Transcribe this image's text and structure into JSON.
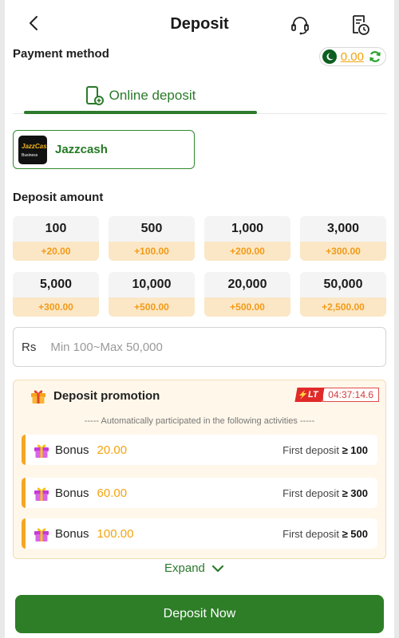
{
  "header": {
    "title": "Deposit"
  },
  "payment": {
    "label": "Payment method",
    "balance": "0.00"
  },
  "tabs": [
    {
      "label": "Online deposit"
    }
  ],
  "method": {
    "name": "Jazzcash",
    "logo_line1": "JazzCash",
    "logo_line2": "Business"
  },
  "deposit_amount": {
    "label": "Deposit amount",
    "options": [
      {
        "value": "100",
        "bonus": "+20.00"
      },
      {
        "value": "500",
        "bonus": "+100.00"
      },
      {
        "value": "1,000",
        "bonus": "+200.00"
      },
      {
        "value": "3,000",
        "bonus": "+300.00"
      },
      {
        "value": "5,000",
        "bonus": "+300.00"
      },
      {
        "value": "10,000",
        "bonus": "+500.00"
      },
      {
        "value": "20,000",
        "bonus": "+500.00"
      },
      {
        "value": "50,000",
        "bonus": "+2,500.00"
      }
    ]
  },
  "amount_input": {
    "currency": "Rs",
    "placeholder": "Min 100~Max 50,000",
    "value": ""
  },
  "promotion": {
    "title": "Deposit promotion",
    "badge": "LT",
    "timer": "04:37:14.6",
    "subtitle": "----- Automatically participated in the following activities -----",
    "bonuses": [
      {
        "label": "Bonus",
        "amount": "20.00",
        "requirement": "First deposit",
        "threshold": "≥ 100"
      },
      {
        "label": "Bonus",
        "amount": "60.00",
        "requirement": "First deposit",
        "threshold": "≥ 300"
      },
      {
        "label": "Bonus",
        "amount": "100.00",
        "requirement": "First deposit",
        "threshold": "≥ 500"
      }
    ]
  },
  "expand_label": "Expand",
  "deposit_button": "Deposit Now",
  "colors": {
    "primary_green": "#2d7e27",
    "accent_orange": "#f3a40e",
    "promo_bg": "#fff7ea",
    "timer_red": "#e02a2a"
  },
  "icons": [
    "back-icon",
    "headset-icon",
    "history-icon",
    "pakistan-flag-icon",
    "refresh-icon",
    "phone-deposit-icon",
    "gift-icon",
    "lightning-icon",
    "chevron-down-icon"
  ]
}
